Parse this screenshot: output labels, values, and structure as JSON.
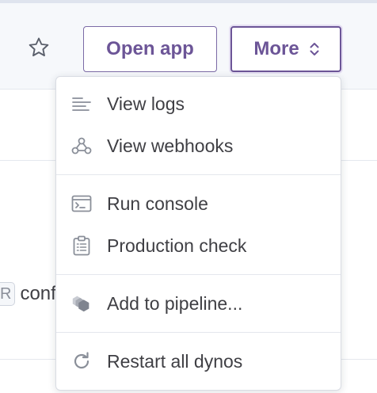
{
  "header": {
    "open_app_label": "Open app",
    "more_label": "More"
  },
  "background": {
    "code_fragment": "R",
    "text_fragment": "conf"
  },
  "menu": {
    "items": [
      {
        "label": "View logs",
        "icon": "logs-icon"
      },
      {
        "label": "View webhooks",
        "icon": "webhooks-icon"
      },
      {
        "label": "Run console",
        "icon": "console-icon"
      },
      {
        "label": "Production check",
        "icon": "clipboard-check-icon"
      },
      {
        "label": "Add to pipeline...",
        "icon": "pipeline-icon"
      },
      {
        "label": "Restart all dynos",
        "icon": "restart-icon"
      }
    ]
  },
  "colors": {
    "accent": "#6c5597",
    "icon": "#8a8f99",
    "text": "#3f3f44",
    "header_bg": "#f6f8fb"
  }
}
